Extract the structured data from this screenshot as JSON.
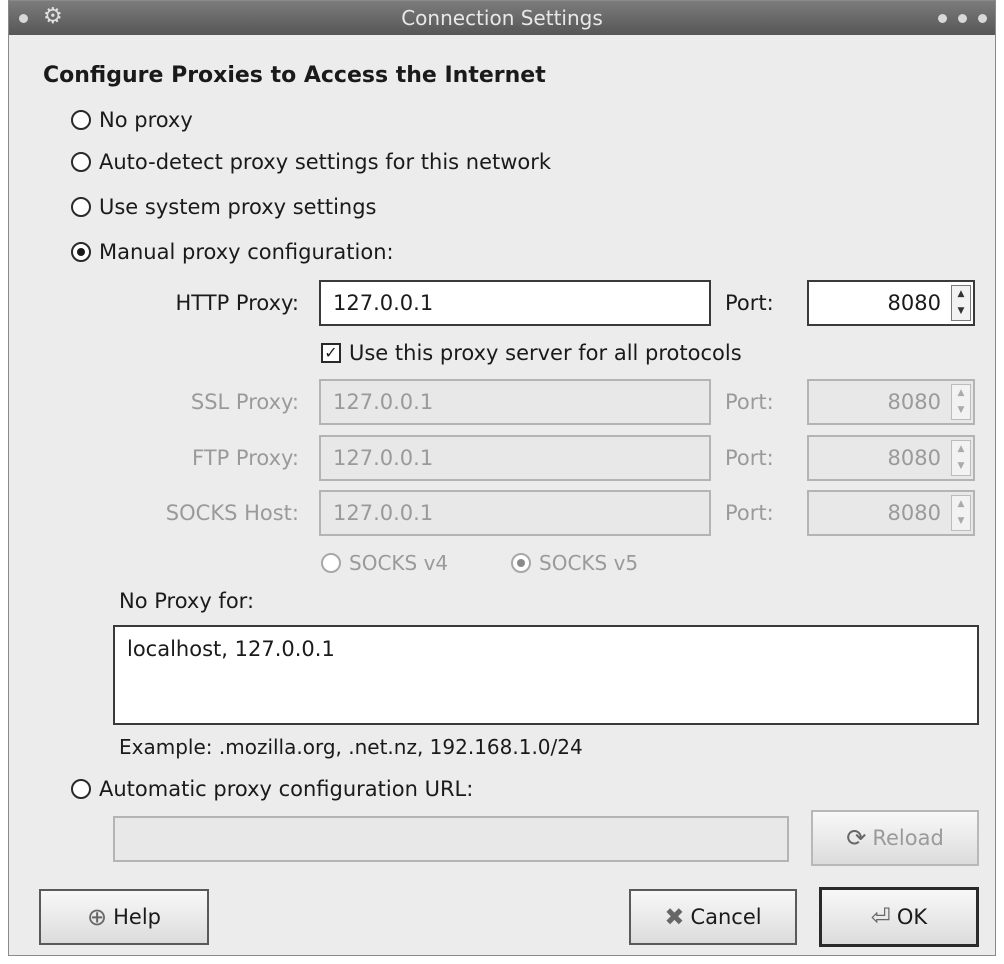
{
  "window": {
    "title": "Connection Settings"
  },
  "heading": "Configure Proxies to Access the Internet",
  "options": {
    "no_proxy": "No proxy",
    "auto_detect": "Auto-detect proxy settings for this network",
    "system": "Use system proxy settings",
    "manual": "Manual proxy configuration:",
    "auto_url": "Automatic proxy configuration URL:"
  },
  "http": {
    "label": "HTTP Proxy:",
    "value": "127.0.0.1",
    "port_label": "Port:",
    "port": "8080"
  },
  "use_all": {
    "label": "Use this proxy server for all protocols",
    "checked": true
  },
  "ssl": {
    "label": "SSL Proxy:",
    "value": "127.0.0.1",
    "port_label": "Port:",
    "port": "8080"
  },
  "ftp": {
    "label": "FTP Proxy:",
    "value": "127.0.0.1",
    "port_label": "Port:",
    "port": "8080"
  },
  "socks": {
    "label": "SOCKS Host:",
    "value": "127.0.0.1",
    "port_label": "Port:",
    "port": "8080"
  },
  "socks_version": {
    "v4": "SOCKS v4",
    "v5": "SOCKS v5",
    "selected": "v5"
  },
  "no_proxy_for": {
    "label": "No Proxy for:",
    "value": "localhost, 127.0.0.1",
    "example": "Example: .mozilla.org, .net.nz, 192.168.1.0/24"
  },
  "auto_url": {
    "value": "",
    "reload": "Reload"
  },
  "buttons": {
    "help": "Help",
    "cancel": "Cancel",
    "ok": "OK"
  },
  "selected_option": "manual",
  "icons": {
    "window": "gear-icon",
    "help": "lifebuoy-icon",
    "cancel": "x-icon",
    "ok": "return-icon",
    "reload": "refresh-icon"
  }
}
